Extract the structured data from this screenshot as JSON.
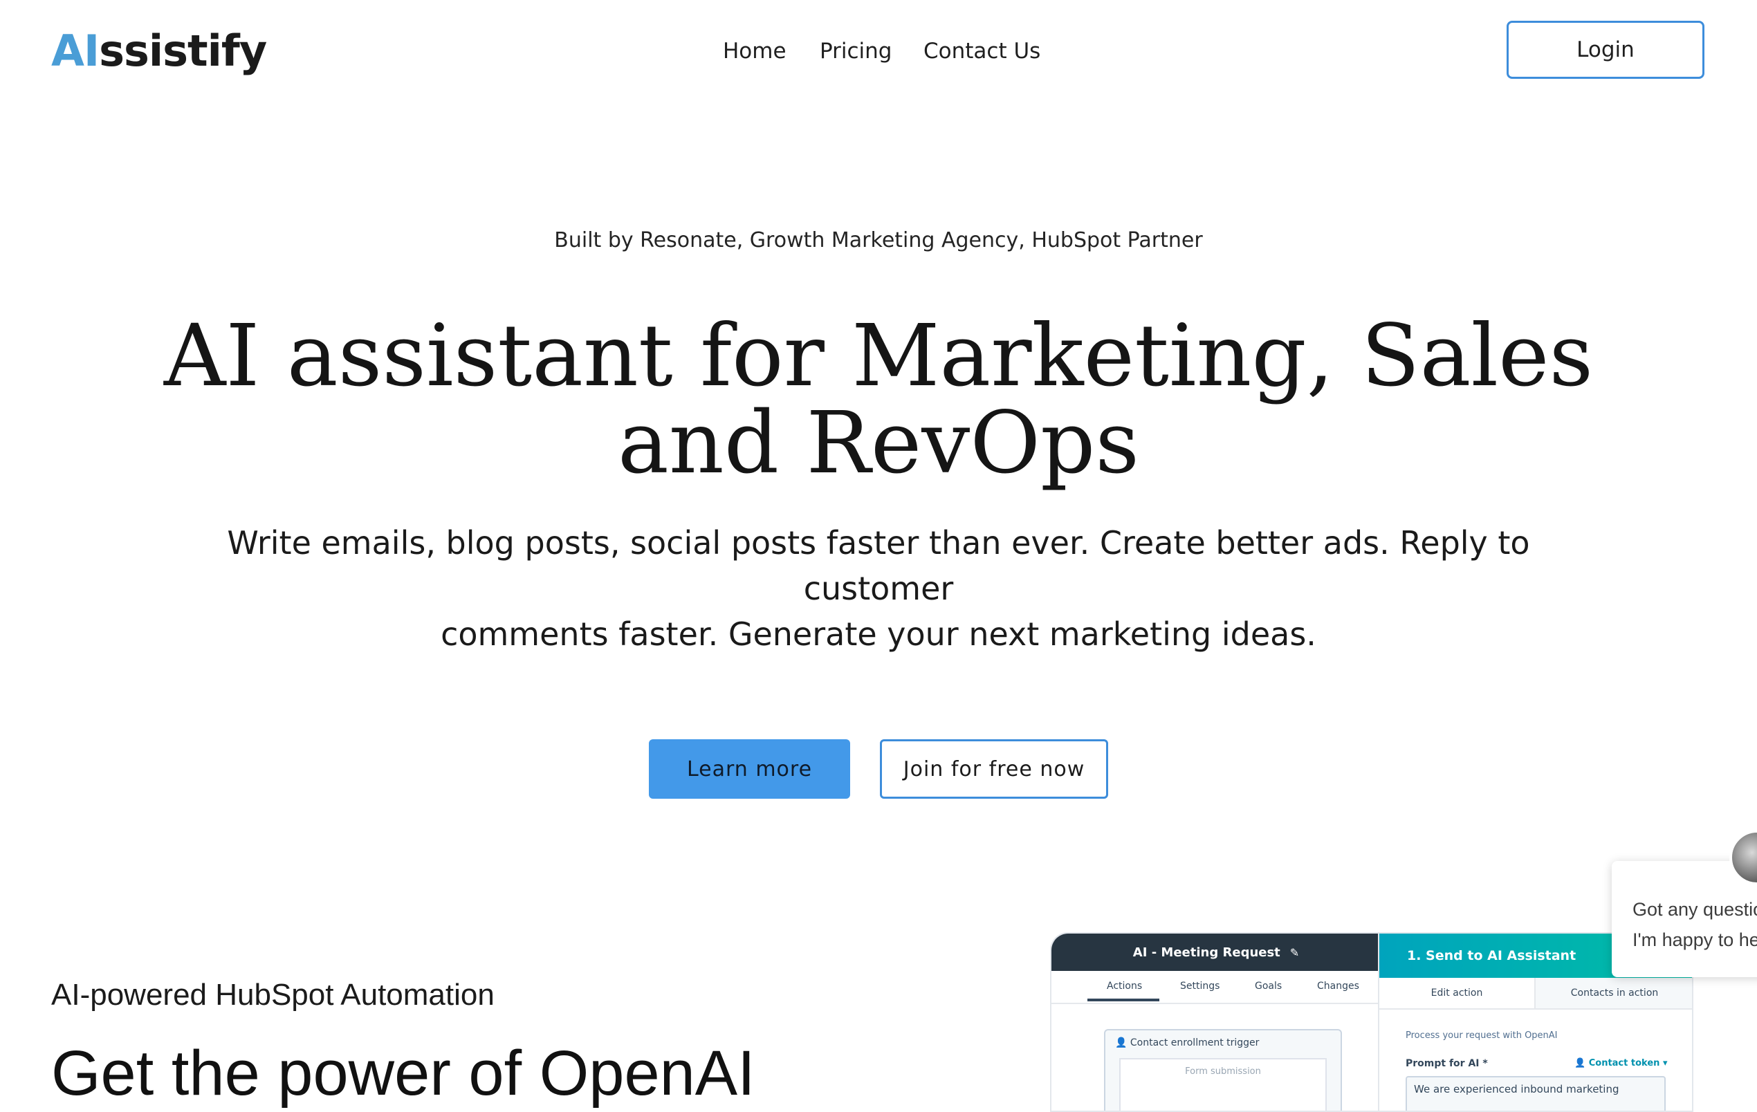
{
  "header": {
    "logo_ai": "AI",
    "logo_rest": "ssistify",
    "nav": [
      "Home",
      "Pricing",
      "Contact Us"
    ],
    "login_label": "Login"
  },
  "hero": {
    "kicker": "Built by Resonate, Growth Marketing Agency, HubSpot Partner",
    "title_line1": "AI assistant for Marketing, Sales",
    "title_line2": "and RevOps",
    "subtitle_line1": "Write emails, blog posts, social posts faster than ever. Create better ads. Reply to customer",
    "subtitle_line2": "comments faster. Generate your next marketing ideas.",
    "learn_more_label": "Learn more",
    "join_label": "Join for free now"
  },
  "section": {
    "kicker": "AI-powered HubSpot Automation",
    "title": "Get the power of OpenAI"
  },
  "mockup": {
    "workflow_title": "AI - Meeting Request",
    "tabs": [
      "Actions",
      "Settings",
      "Goals",
      "Changes"
    ],
    "trigger_label": "Contact enrollment trigger",
    "trigger_inner": "Form submission",
    "action_title": "1. Send to AI Assistant",
    "action_tabs": [
      "Edit action",
      "Contacts in action"
    ],
    "process_text": "Process your request with OpenAI",
    "prompt_label": "Prompt for AI *",
    "contact_token": "Contact token",
    "prompt_text": "We are experienced inbound marketing"
  },
  "chat": {
    "message": "Got any questions? I'm happy to help."
  },
  "colors": {
    "accent": "#4399e9",
    "logo_ai": "#4a9dd6",
    "outline": "#3d8ddb"
  }
}
